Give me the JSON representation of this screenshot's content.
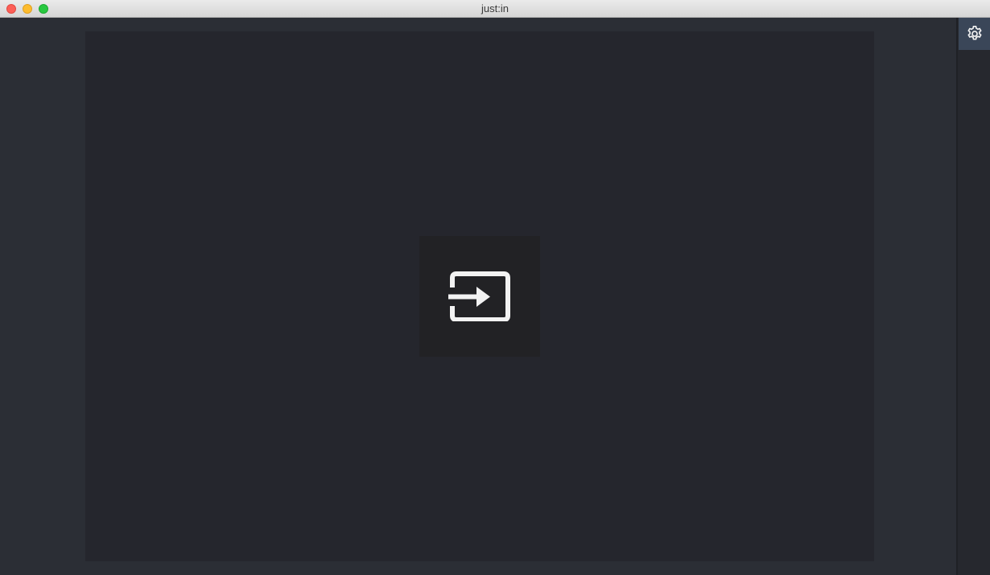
{
  "window": {
    "title": "just:in"
  },
  "main": {
    "enter_icon": "enter-input-icon"
  },
  "sidebar": {
    "settings_icon": "gear-icon"
  },
  "colors": {
    "background": "#2b2e35",
    "canvas": "#25262d",
    "tile": "#222225",
    "settings_button": "#3a4658",
    "icon": "#f2f2f2"
  }
}
